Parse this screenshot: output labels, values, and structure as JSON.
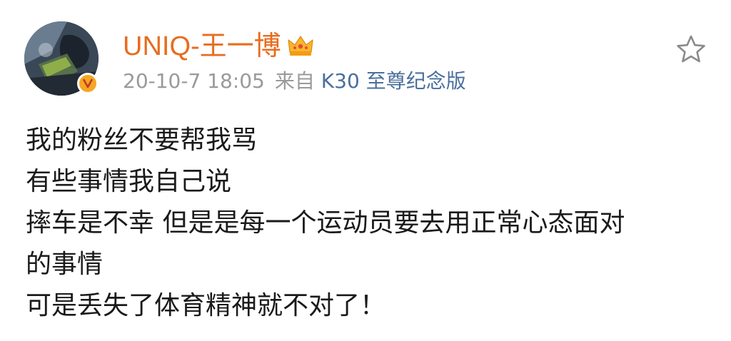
{
  "post": {
    "username": "UNIQ-王一博",
    "timestamp": "20-10-7 18:05",
    "source_prefix": "来自",
    "source_device": "K30 至尊纪念版",
    "lines": [
      "我的粉丝不要帮我骂",
      "有些事情我自己说",
      "摔车是不幸 但是是每一个运动员要去用正常心态面对",
      "的事情",
      "可是丢失了体育精神就不对了！"
    ]
  },
  "icons": {
    "badge": "verified-v-icon",
    "crown": "crown-icon",
    "star": "star-outline-icon"
  },
  "colors": {
    "username": "#e86c1f",
    "meta": "#9a9a9a",
    "source_link": "#4a6f9c",
    "badge": "#f5a623",
    "text": "#1a1a1a"
  }
}
